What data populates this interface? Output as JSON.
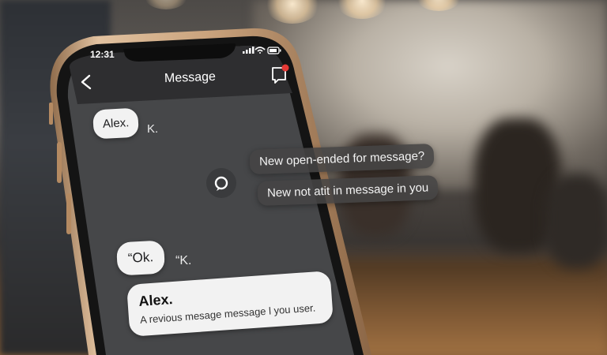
{
  "status_bar": {
    "time": "12:31"
  },
  "header": {
    "title": "Message",
    "back_icon": "chevron-left-icon",
    "compose_icon": "compose-icon",
    "notification_color": "#e53935"
  },
  "messages": [
    {
      "bubble": "Alex.",
      "trailing": "K."
    },
    {
      "bubble": "“Ok.",
      "trailing": "“K."
    }
  ],
  "suggestions": [
    "New open-ended for message?",
    "New not atit in message in you"
  ],
  "preview": {
    "sender": "Alex.",
    "text": "A revious mesage message l you user."
  },
  "colors": {
    "screen": "#464749",
    "header": "#2e2e30",
    "bubble": "#f2f2f2",
    "frame": "#c9a27c"
  }
}
